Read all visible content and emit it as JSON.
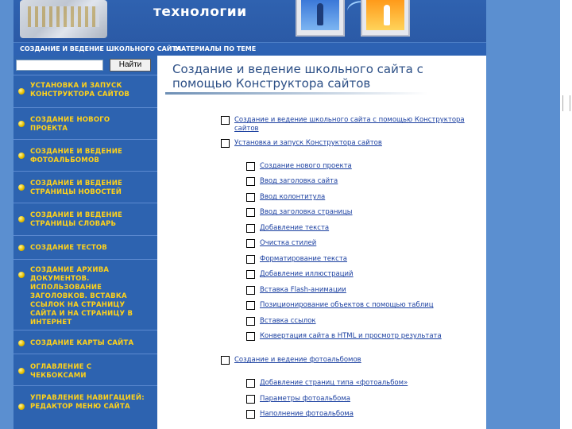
{
  "header": {
    "logo_text": "технологии"
  },
  "nav": {
    "items": [
      "СОЗДАНИЕ И ВЕДЕНИЕ ШКОЛЬНОГО САЙТА",
      "МАТЕРИАЛЫ ПО ТЕМЕ"
    ]
  },
  "search": {
    "value": "",
    "button_label": "Найти"
  },
  "sidebar": {
    "items": [
      "УСТАНОВКА И ЗАПУСК КОНСТРУКТОРА САЙТОВ",
      "СОЗДАНИЕ НОВОГО ПРОЕКТА",
      "СОЗДАНИЕ И ВЕДЕНИЕ ФОТОАЛЬБОМОВ",
      "СОЗДАНИЕ И ВЕДЕНИЕ СТРАНИЦЫ НОВОСТЕЙ",
      "СОЗДАНИЕ И ВЕДЕНИЕ СТРАНИЦЫ СЛОВАРЬ",
      "СОЗДАНИЕ ТЕСТОВ",
      "СОЗДАНИЕ АРХИВА ДОКУМЕНТОВ. ИСПОЛЬЗОВАНИЕ ЗАГОЛОВКОВ. ВСТАВКА ССЫЛОК НА СТРАНИЦУ САЙТА И НА СТРАНИЦУ В ИНТЕРНЕТ",
      "СОЗДАНИЕ КАРТЫ САЙТА",
      "ОГЛАВЛЕНИЕ С ЧЕКБОКСАМИ",
      "УПРАВЛЕНИЕ НАВИГАЦИЕЙ: РЕДАКТОР МЕНЮ САЙТА"
    ]
  },
  "main": {
    "title": "Создание и ведение школьного сайта с помощью Конструктора сайтов",
    "toc": [
      {
        "level": 1,
        "text": "Создание и ведение школьного сайта с помощью Конструктора сайтов"
      },
      {
        "level": 1,
        "text": "Установка и запуск Конструктора сайтов"
      },
      {
        "level": 2,
        "text": "Создание нового проекта"
      },
      {
        "level": 2,
        "text": "Ввод заголовка сайта"
      },
      {
        "level": 2,
        "text": "Ввод колонтитула"
      },
      {
        "level": 2,
        "text": "Ввод заголовка страницы"
      },
      {
        "level": 2,
        "text": "Добавление текста"
      },
      {
        "level": 2,
        "text": "Очистка стилей"
      },
      {
        "level": 2,
        "text": "Форматирование текста"
      },
      {
        "level": 2,
        "text": "Добавление иллюстраций"
      },
      {
        "level": 2,
        "text": "Вставка Flash-анимации"
      },
      {
        "level": 2,
        "text": "Позиционирование объектов с помощью таблиц"
      },
      {
        "level": 2,
        "text": "Вставка ссылок"
      },
      {
        "level": 2,
        "text": "Конвертация сайта в HTML и просмотр результата"
      },
      {
        "level": 1,
        "text": "Создание и ведение фотоальбомов"
      },
      {
        "level": 2,
        "text": "Добавление страниц типа «фотоальбом»"
      },
      {
        "level": 2,
        "text": "Параметры фотоальбома"
      },
      {
        "level": 2,
        "text": "Наполнение фотоальбома"
      }
    ]
  }
}
